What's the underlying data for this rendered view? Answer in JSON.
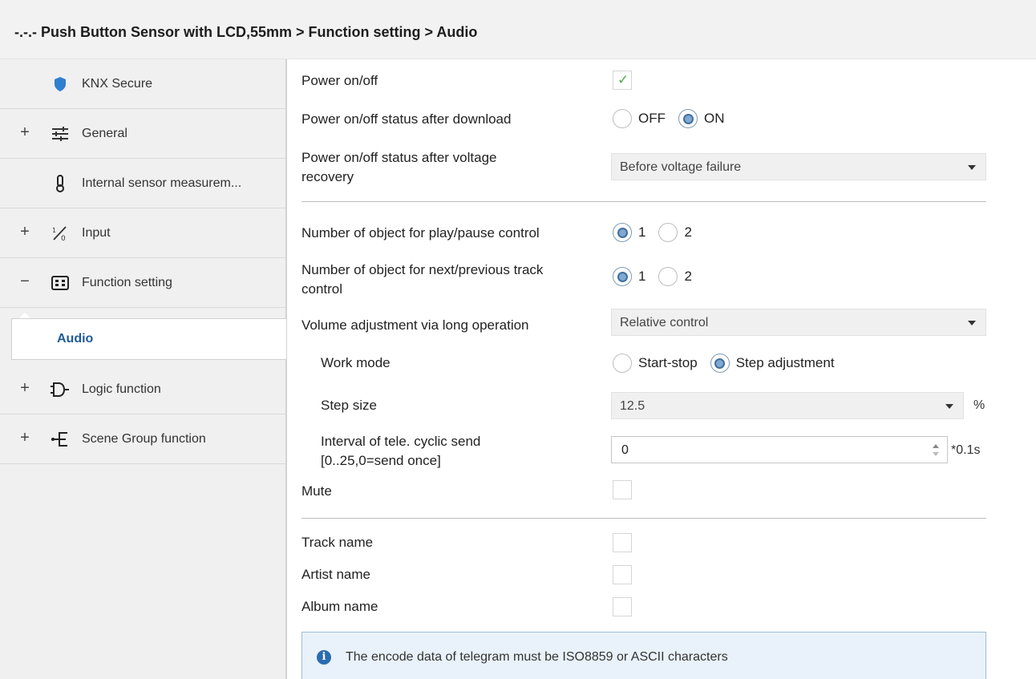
{
  "header": {
    "title": "-.-.- Push Button Sensor with LCD,55mm > Function setting > Audio"
  },
  "sidebar": {
    "items": [
      {
        "label": "KNX Secure",
        "expander": "",
        "icon": "shield-icon"
      },
      {
        "label": "General",
        "expander": "+",
        "icon": "sliders-icon"
      },
      {
        "label": "Internal sensor measurem...",
        "expander": "",
        "icon": "thermometer-icon"
      },
      {
        "label": "Input",
        "expander": "+",
        "icon": "input-switch-icon"
      },
      {
        "label": "Function setting",
        "expander": "−",
        "icon": "function-panel-icon"
      },
      {
        "label": "Audio",
        "expander": "",
        "icon": ""
      },
      {
        "label": "Logic function",
        "expander": "+",
        "icon": "logic-gate-icon"
      },
      {
        "label": "Scene Group function",
        "expander": "+",
        "icon": "scene-group-icon"
      }
    ]
  },
  "params": {
    "power": {
      "label": "Power on/off",
      "checked": true
    },
    "power_download": {
      "label": "Power on/off  status after download",
      "options": [
        "OFF",
        "ON"
      ],
      "selected": "ON"
    },
    "power_recovery": {
      "label_line1": "Power on/off status after voltage",
      "label_line2": "recovery",
      "value": "Before voltage failure"
    },
    "play_pause": {
      "label": "Number of object for play/pause control",
      "options": [
        "1",
        "2"
      ],
      "selected": "1"
    },
    "next_prev": {
      "label_line1": "Number of object for next/previous track",
      "label_line2": "control",
      "options": [
        "1",
        "2"
      ],
      "selected": "1"
    },
    "volume": {
      "label": "Volume adjustment via long operation",
      "value": "Relative control"
    },
    "work_mode": {
      "label": "Work mode",
      "options": [
        "Start-stop",
        "Step adjustment"
      ],
      "selected": "Step adjustment"
    },
    "step_size": {
      "label": "Step size",
      "value": "12.5",
      "unit": "%"
    },
    "interval": {
      "label_line1": "Interval of tele. cyclic send",
      "label_line2": "[0..25,0=send once]",
      "value": "0",
      "unit": "*0.1s"
    },
    "mute": {
      "label": "Mute",
      "checked": false
    },
    "track_name": {
      "label": "Track name",
      "checked": false
    },
    "artist_name": {
      "label": "Artist name",
      "checked": false
    },
    "album_name": {
      "label": "Album name",
      "checked": false
    }
  },
  "info": {
    "text": "The encode data of telegram must be ISO8859 or ASCII characters",
    "icon": "info-icon"
  },
  "colors": {
    "accent": "#1f5c94",
    "sidebar_bg": "#f0f0f0",
    "info_bg": "#e9f2fb",
    "check_green": "#4caf50"
  }
}
